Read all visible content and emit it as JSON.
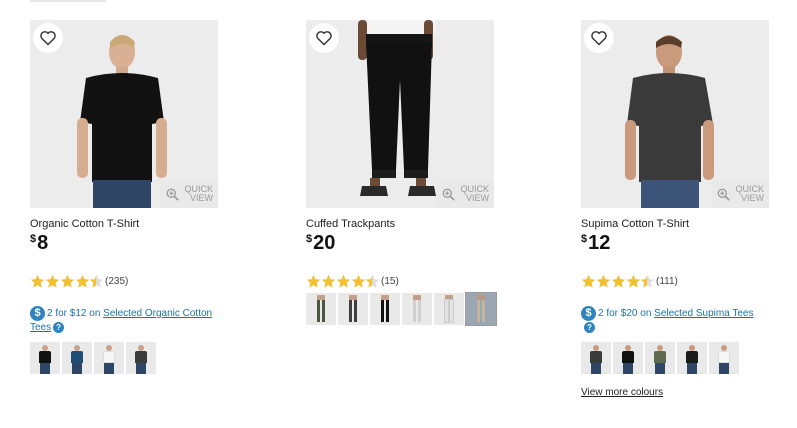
{
  "products": [
    {
      "name": "Organic Cotton T-Shirt",
      "currency": "$",
      "price": "8",
      "rating": 4.5,
      "review_count": "(235)",
      "promo": {
        "text": "2 for $12 on ",
        "link": "Selected Organic Cotton Tees"
      },
      "quick_view": "QUICK VIEW",
      "swatches": [
        "#111111",
        "#1f4d73",
        "#f2f2f2",
        "#3b3b3b"
      ]
    },
    {
      "name": "Cuffed Trackpants",
      "currency": "$",
      "price": "20",
      "rating": 4.5,
      "review_count": "(15)",
      "quick_view": "QUICK VIEW",
      "swatches": [
        "#4a5640",
        "#3d3d3d",
        "#111111",
        "#cfcfcf",
        "#e3e3e3",
        "#9aa7b3"
      ]
    },
    {
      "name": "Supima Cotton T-Shirt",
      "currency": "$",
      "price": "12",
      "rating": 4.5,
      "review_count": "(111)",
      "promo": {
        "text": "2 for $20 on ",
        "link": "Selected Supima Tees"
      },
      "quick_view": "QUICK VIEW",
      "swatches": [
        "#3a3a3a",
        "#111111",
        "#5f6b4e",
        "#1b1b1b",
        "#f2f2f2"
      ],
      "view_more": "View more colours"
    }
  ],
  "colors": {
    "star": "#f3c12f",
    "link": "#1a73a8",
    "promo_badge": "#2f83bf"
  },
  "icons": {
    "favorite": "heart-outline-icon",
    "quick_view": "magnifier-plus-icon",
    "promo": "dollar-circle-icon",
    "help": "question-circle-icon"
  }
}
